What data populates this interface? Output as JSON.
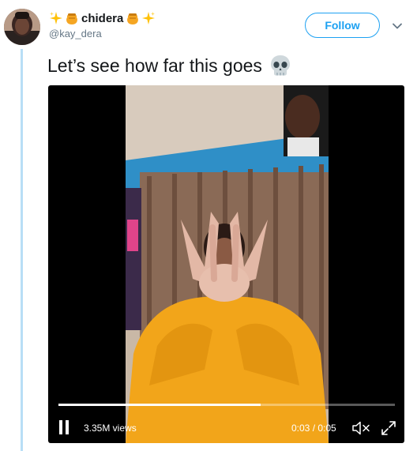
{
  "author": {
    "name": "chidera",
    "handle": "@kay_dera",
    "name_decorations": [
      "sparkles-icon",
      "honey-pot-icon",
      "honey-pot-icon",
      "sparkles-icon"
    ]
  },
  "follow_button": {
    "label": "Follow"
  },
  "menu_icon": "chevron-down-icon",
  "tweet": {
    "text": "Let’s see how far this goes",
    "emoji": "skull-icon"
  },
  "video": {
    "views": "3.35M views",
    "time": "0:03 / 0:05",
    "progress": 0.6,
    "controls": [
      "pause-icon",
      "mute-icon",
      "fullscreen-icon"
    ]
  },
  "colors": {
    "accent": "#1da1f2",
    "thread_line": "#b8def6",
    "text_primary": "#14171a",
    "text_secondary": "#657786"
  }
}
